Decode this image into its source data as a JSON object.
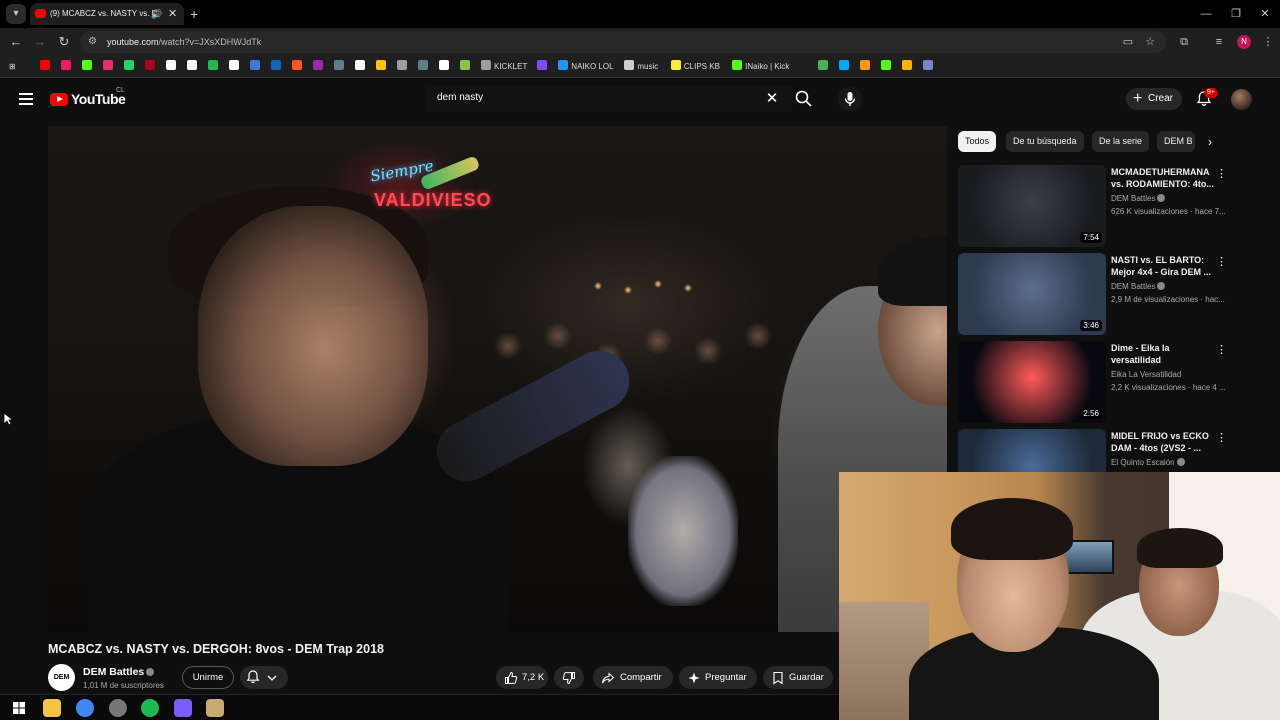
{
  "browser": {
    "tab_title": "(9) MCABCZ vs. NASTY vs. D",
    "url_host": "youtube.com",
    "url_path": "/watch?v=JXsXDHWJdTk",
    "profile_initial": "N"
  },
  "bookmarks": [
    {
      "label": "",
      "color": "#ff0000"
    },
    {
      "label": "",
      "color": "#e91e63"
    },
    {
      "label": "",
      "color": "#53fc18"
    },
    {
      "label": "",
      "color": "#e1306c"
    },
    {
      "label": "",
      "color": "#25d366"
    },
    {
      "label": "",
      "color": "#b00020"
    },
    {
      "label": "",
      "color": "#ffffff"
    },
    {
      "label": "",
      "color": "#ffffff"
    },
    {
      "label": "",
      "color": "#1db954"
    },
    {
      "label": "",
      "color": "#ffffff"
    },
    {
      "label": "",
      "color": "#3a7bd5"
    },
    {
      "label": "",
      "color": "#1565c0"
    },
    {
      "label": "",
      "color": "#ff5722"
    },
    {
      "label": "",
      "color": "#9c27b0"
    },
    {
      "label": "",
      "color": "#607d8b"
    },
    {
      "label": "",
      "color": "#ffffff"
    },
    {
      "label": "",
      "color": "#ffc107"
    },
    {
      "label": "",
      "color": "#9e9e9e"
    },
    {
      "label": "",
      "color": "#607d8b"
    },
    {
      "label": "",
      "color": "#ffffff"
    },
    {
      "label": "",
      "color": "#8bc34a"
    },
    {
      "label": "KICKLET",
      "color": "#9e9e9e"
    },
    {
      "label": "",
      "color": "#7c4dff"
    },
    {
      "label": "NAIKO LOL",
      "color": "#2196f3"
    },
    {
      "label": "music",
      "color": "#cfcfcf"
    },
    {
      "label": "CLIPS KB",
      "color": "#ffeb3b"
    },
    {
      "label": "INaiko | Kick",
      "color": "#53fc18"
    },
    {
      "label": "",
      "color": "#4caf50"
    },
    {
      "label": "",
      "color": "#03a9f4"
    },
    {
      "label": "",
      "color": "#ff9800"
    },
    {
      "label": "",
      "color": "#53fc18"
    },
    {
      "label": "",
      "color": "#ffb300"
    },
    {
      "label": "",
      "color": "#7986cb"
    }
  ],
  "youtube": {
    "logo_text": "YouTube",
    "country": "CL",
    "search_query": "dem nasty",
    "create_label": "Crear",
    "notif_count": "9+"
  },
  "chips": [
    "Todos",
    "De tu búsqueda",
    "De la serie",
    "DEM B"
  ],
  "recommendations": [
    {
      "title": "MCMADETUHERMANA vs. RODAMIENTO: 4to...",
      "channel": "DEM Battles",
      "verified": true,
      "meta": "626 K visualizaciones · hace 7...",
      "duration": "7:54",
      "thumb_a": "#3a3f4a",
      "thumb_b": "#1a1c20"
    },
    {
      "title": "NASTI vs. EL BARTO: Mejor 4x4 - Gira DEM ...",
      "channel": "DEM Battles",
      "verified": true,
      "meta": "2,9 M de visualizaciones · hac...",
      "duration": "3:46",
      "thumb_a": "#5b6f8c",
      "thumb_b": "#2d3a4f"
    },
    {
      "title": "Dime - Eika la versatilidad",
      "channel": "Eika La Versatilidad",
      "verified": false,
      "meta": "2,2 K visualizaciones · hace 4 ...",
      "duration": "2:56",
      "thumb_a": "#ff5a5a",
      "thumb_b": "#080810"
    },
    {
      "title": "MIDEL FRIJO vs ECKO DAM - 4tos (2VS2 - ...",
      "channel": "El Quinto Escalón",
      "verified": true,
      "meta": "",
      "duration": "",
      "thumb_a": "#4a6a9a",
      "thumb_b": "#1e2a3a"
    }
  ],
  "video": {
    "title": "MCABCZ vs. NASTY vs. DERGOH: 8vos - DEM Trap 2018",
    "channel": "DEM Battles",
    "channel_avatar_text": "DEM",
    "subscribers": "1,01 M de suscriptores",
    "join_label": "Unirme",
    "likes": "7,2 K",
    "share_label": "Compartir",
    "ask_label": "Preguntar",
    "save_label": "Guardar",
    "neon_sign_top": "Siempre",
    "neon_sign_bottom": "VALDIVIESO"
  },
  "taskbar_icons": [
    {
      "name": "windows-start-icon",
      "color": "#ffffff"
    },
    {
      "name": "file-explorer-icon",
      "color": "#f4c542"
    },
    {
      "name": "chrome-icon",
      "color": "#4285f4"
    },
    {
      "name": "obs-icon",
      "color": "#777777"
    },
    {
      "name": "spotify-icon",
      "color": "#1db954"
    },
    {
      "name": "discord-icon",
      "color": "#7a5cff"
    },
    {
      "name": "league-icon",
      "color": "#c8aa6e"
    }
  ]
}
